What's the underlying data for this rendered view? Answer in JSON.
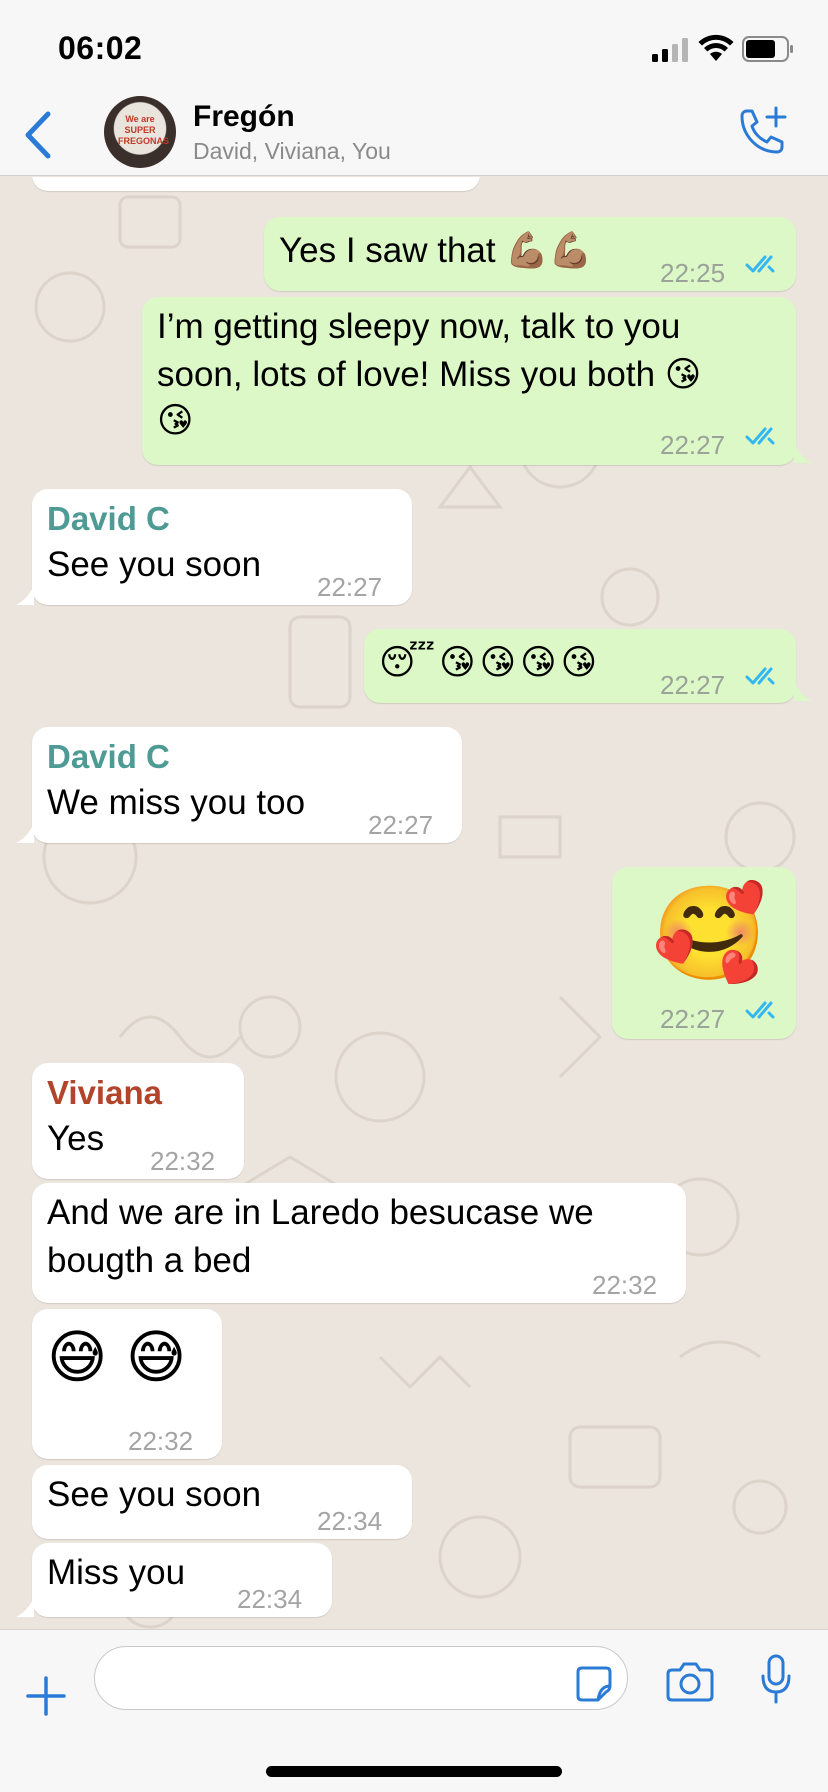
{
  "status_bar": {
    "time": "06:02"
  },
  "header": {
    "title": "Fregón",
    "subtitle": "David, Viviana, You",
    "avatar_text": "We are SUPER FREGONAS"
  },
  "colors": {
    "accent": "#2b7bd6",
    "outgoing_bubble": "#dcf8c6",
    "incoming_bubble": "#ffffff",
    "sender_david": "#4e9a94",
    "sender_viviana": "#b1442a",
    "read_ticks": "#34b7f1"
  },
  "messages": [
    {
      "direction": "out",
      "text": "Yes I saw that 💪🏽💪🏽",
      "time": "22:25",
      "read": true
    },
    {
      "direction": "out",
      "text_lines": [
        "I’m getting sleepy now, talk to you",
        "soon, lots of love! Miss you both 😘",
        "😘"
      ],
      "time": "22:27",
      "read": true
    },
    {
      "direction": "in",
      "sender": "David C",
      "text": "See you soon",
      "time": "22:27"
    },
    {
      "direction": "out",
      "text": "😴😘😘😘😘",
      "time": "22:27",
      "read": true
    },
    {
      "direction": "in",
      "sender": "David C",
      "text": "We miss you too",
      "time": "22:27"
    },
    {
      "direction": "out",
      "text": "🥰",
      "time": "22:27",
      "read": true
    },
    {
      "direction": "in",
      "sender": "Viviana",
      "text": "Yes",
      "time": "22:32"
    },
    {
      "direction": "in",
      "text_lines": [
        "And we are in Laredo besucase we",
        "bougth a bed"
      ],
      "time": "22:32"
    },
    {
      "direction": "in",
      "text": "😅 😅",
      "time": "22:32"
    },
    {
      "direction": "in",
      "text": "See you soon",
      "time": "22:34"
    },
    {
      "direction": "in",
      "text": "Miss you",
      "time": "22:34"
    }
  ],
  "input": {
    "placeholder": ""
  },
  "icons": {
    "back": "chevron-left-icon",
    "call": "add-call-icon",
    "plus": "plus-icon",
    "sticker": "sticker-icon",
    "camera": "camera-icon",
    "mic": "microphone-icon"
  }
}
